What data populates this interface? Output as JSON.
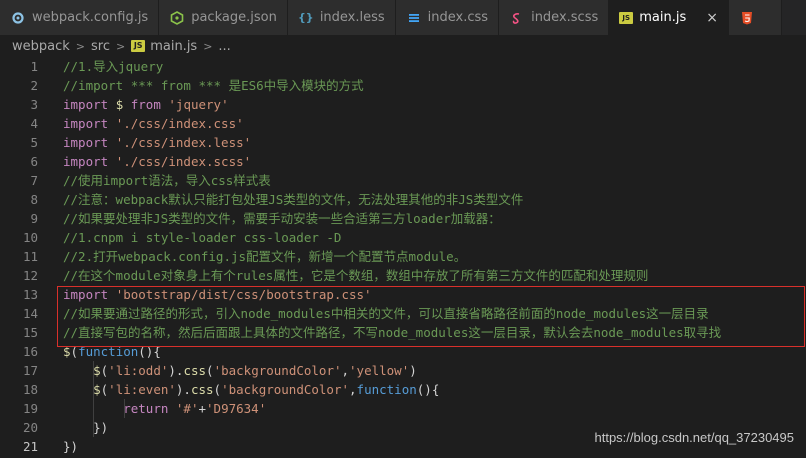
{
  "tabs": [
    {
      "label": "webpack.config.js",
      "icon": "gear-icon",
      "active": false
    },
    {
      "label": "package.json",
      "icon": "npm-icon",
      "active": false
    },
    {
      "label": "index.less",
      "icon": "braces-icon",
      "active": false
    },
    {
      "label": "index.css",
      "icon": "css-icon",
      "active": false
    },
    {
      "label": "index.scss",
      "icon": "sass-icon",
      "active": false
    },
    {
      "label": "main.js",
      "icon": "js-icon",
      "active": true
    },
    {
      "label": "",
      "icon": "html5-icon",
      "active": false
    }
  ],
  "tab_icons": {
    "js": "JS",
    "braces": "{}",
    "close": "×"
  },
  "breadcrumb": {
    "project": "webpack",
    "folder": "src",
    "file": "main.js",
    "symbol": "..."
  },
  "lines": [
    {
      "n": "1",
      "text": "//1.导入jquery"
    },
    {
      "n": "2",
      "text": "//import *** from *** 是ES6中导入模块的方式"
    },
    {
      "n": "3",
      "text": "import $ from 'jquery'"
    },
    {
      "n": "4",
      "text": "import './css/index.css'"
    },
    {
      "n": "5",
      "text": "import './css/index.less'"
    },
    {
      "n": "6",
      "text": "import './css/index.scss'"
    },
    {
      "n": "7",
      "text": "//使用import语法，导入css样式表"
    },
    {
      "n": "8",
      "text": "//注意：webpack默认只能打包处理JS类型的文件，无法处理其他的非JS类型文件"
    },
    {
      "n": "9",
      "text": "//如果要处理非JS类型的文件，需要手动安装一些合适第三方loader加载器："
    },
    {
      "n": "10",
      "text": "//1.cnpm i style-loader css-loader -D"
    },
    {
      "n": "11",
      "text": "//2.打开webpack.config.js配置文件，新增一个配置节点module。"
    },
    {
      "n": "12",
      "text": "//在这个module对象身上有个rules属性，它是个数组，数组中存放了所有第三方文件的匹配和处理规则"
    },
    {
      "n": "13",
      "text": "import 'bootstrap/dist/css/bootstrap.css'"
    },
    {
      "n": "14",
      "text": "//如果要通过路径的形式，引入node_modules中相关的文件，可以直接省略路径前面的node_modules这一层目录"
    },
    {
      "n": "15",
      "text": "//直接写包的名称，然后后面跟上具体的文件路径，不写node_modules这一层目录，默认会去node_modules取寻找"
    },
    {
      "n": "16",
      "text": "$(function(){"
    },
    {
      "n": "17",
      "text": "    $('li:odd').css('backgroundColor','yellow')"
    },
    {
      "n": "18",
      "text": "    $('li:even').css('backgroundColor',function(){"
    },
    {
      "n": "19",
      "text": "        return '#'+'D97634'"
    },
    {
      "n": "20",
      "text": "    })"
    },
    {
      "n": "21",
      "text": "})"
    }
  ],
  "watermark": "https://blog.csdn.net/qq_37230495",
  "colors": {
    "highlight_box": "#d9302b",
    "comment": "#6a9955",
    "keyword": "#c586c0",
    "string": "#ce9178"
  }
}
